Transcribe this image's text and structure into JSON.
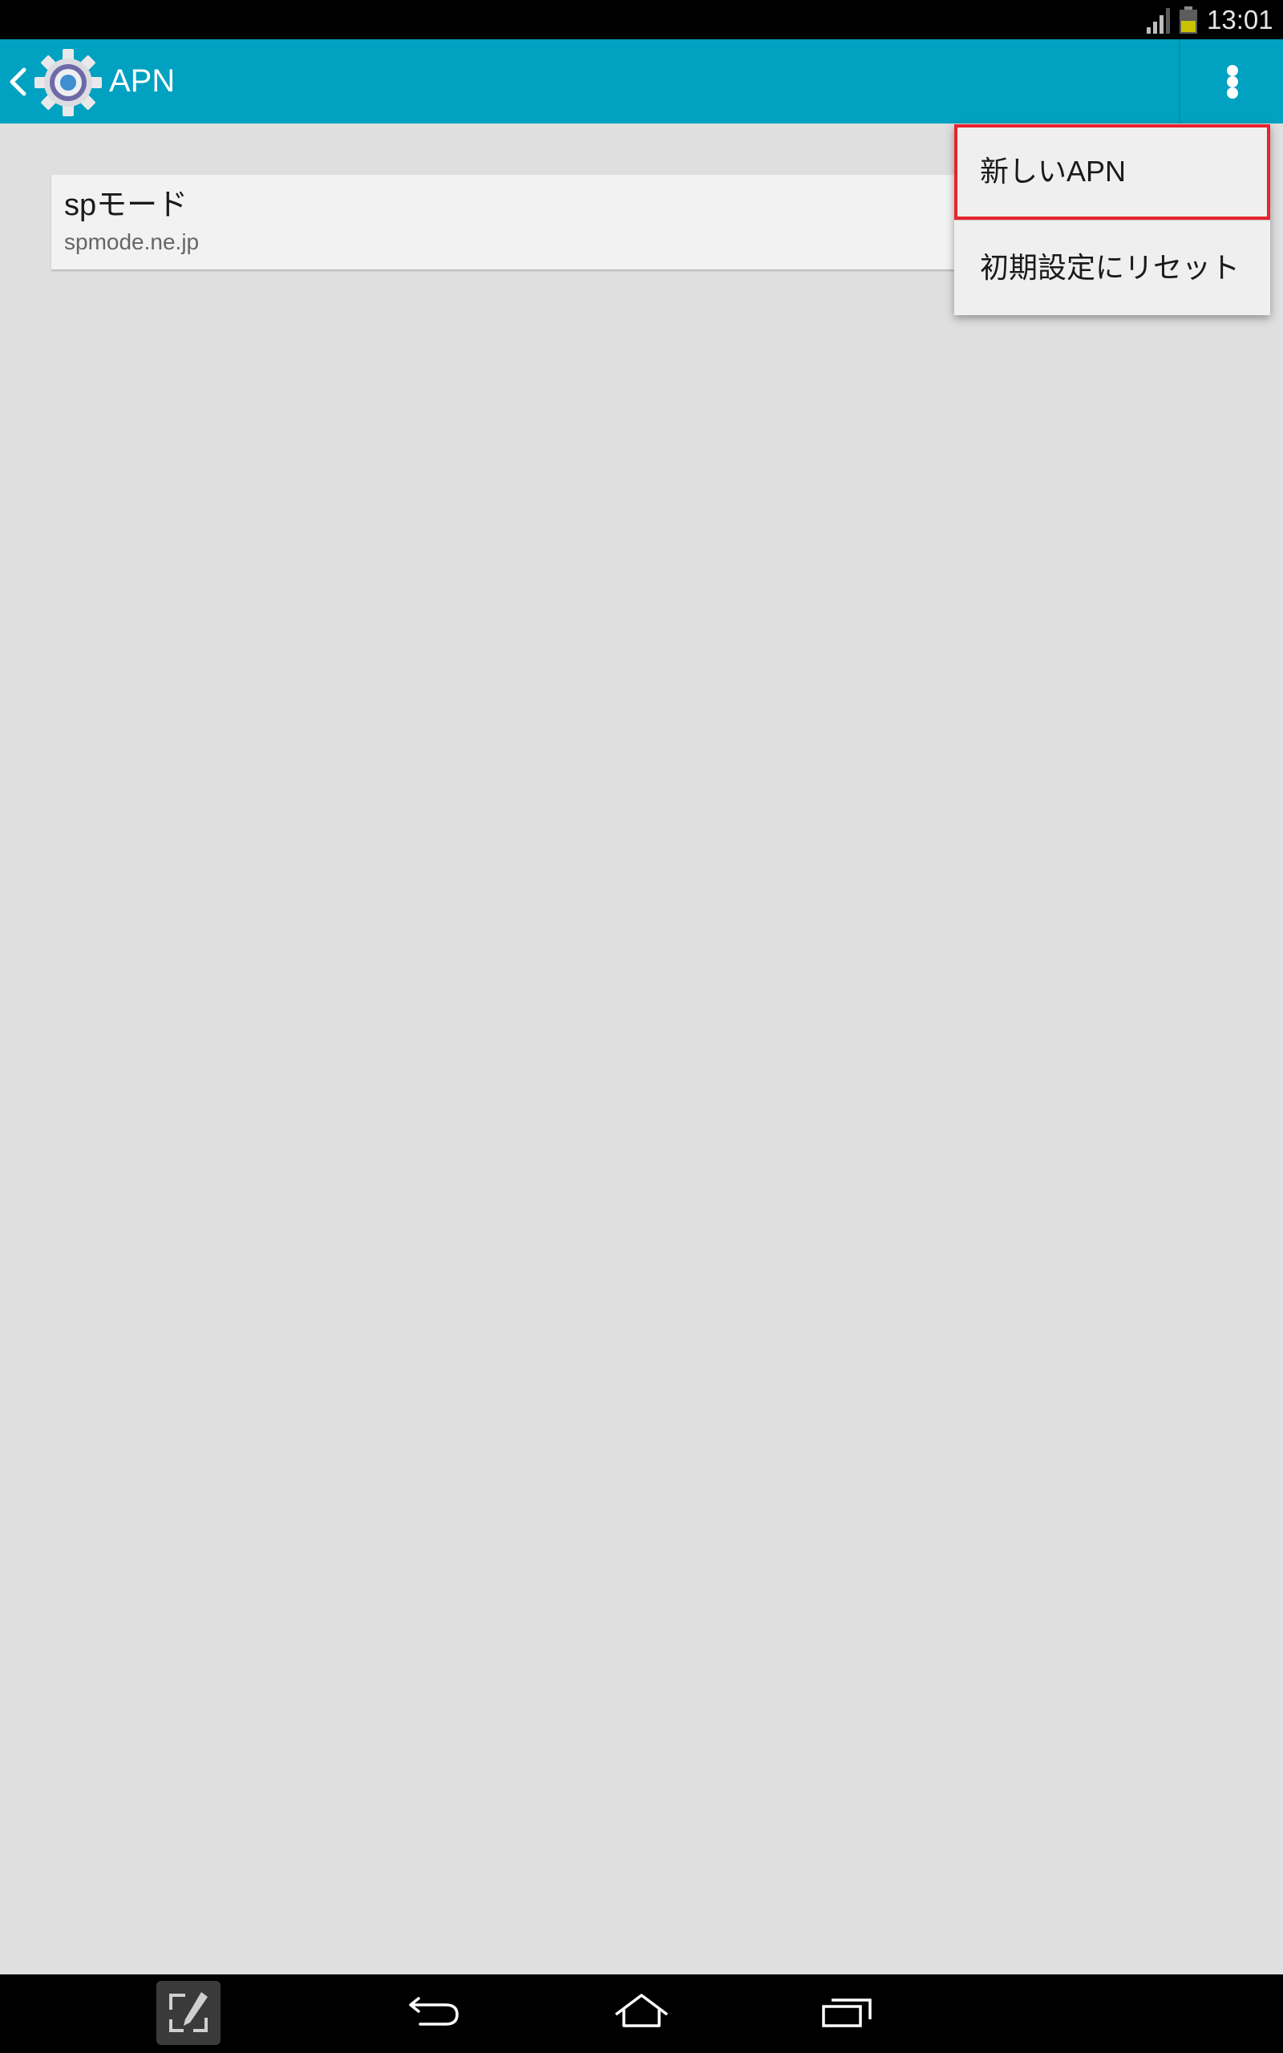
{
  "status_bar": {
    "time": "13:01",
    "icons": [
      "signal-icon",
      "battery-icon"
    ],
    "battery_color": "#c8c200"
  },
  "action_bar": {
    "title": "APN",
    "background": "#01a1c1",
    "icons": [
      "back-icon",
      "settings-gear-icon",
      "overflow-menu-icon"
    ]
  },
  "apn_list": [
    {
      "name": "spモード",
      "address": "spmode.ne.jp"
    }
  ],
  "overflow_menu": {
    "items": [
      {
        "label": "新しいAPN",
        "highlighted": true,
        "highlight_color": "#e8242e"
      },
      {
        "label": "初期設定にリセット",
        "highlighted": false
      }
    ]
  },
  "navigation_bar": {
    "icons": [
      "pen-window-icon",
      "back-arrow-icon",
      "home-icon",
      "recent-apps-icon"
    ]
  }
}
